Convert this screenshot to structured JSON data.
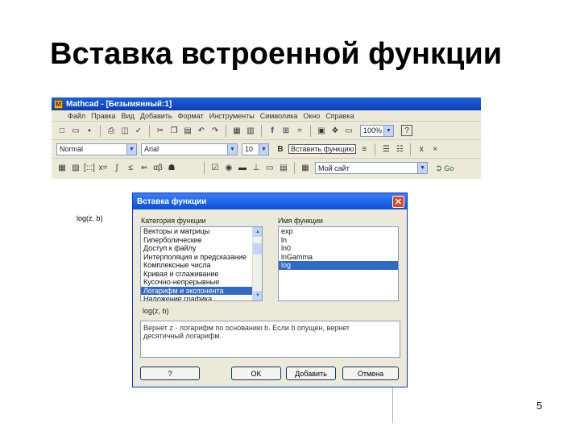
{
  "slide": {
    "title": "Вставка встроенной функции",
    "page_number": "5"
  },
  "app": {
    "title": "Mathcad - [Безымянный:1]",
    "menu": [
      "Файл",
      "Правка",
      "Вид",
      "Добавить",
      "Формат",
      "Инструменты",
      "Символика",
      "Окно",
      "Справка"
    ],
    "zoom_value": "100%",
    "style_value": "Normal",
    "font_value": "Arial",
    "font_size_value": "10",
    "insert_function_label": "Вставить функцию",
    "address_value": "Мой сайт",
    "go_label": "Go"
  },
  "worksheet": {
    "function_placeholder": "log(z, b)"
  },
  "dialog": {
    "title": "Вставка функции",
    "category_label": "Категория функции",
    "name_label": "Имя функции",
    "categories": [
      "Векторы и матрицы",
      "Гиперболические",
      "Доступ к файлу",
      "Интерполяция и предсказание",
      "Комплексные числа",
      "Кривая и сглаживание",
      "Кусочно-непрерывные",
      "Логарифм и экспонента",
      "Наложение графика"
    ],
    "selected_category_index": 7,
    "functions": [
      "exp",
      "ln",
      "ln0",
      "lnGamma",
      "log"
    ],
    "selected_function_index": 4,
    "syntax": "log(z, b)",
    "description": "Вернет z - логарифм по основанию b. Если b опущен, вернет десятичный логарифм.",
    "help_button": "?",
    "ok_button": "OK",
    "insert_button": "Добавить",
    "cancel_button": "Отмена"
  }
}
